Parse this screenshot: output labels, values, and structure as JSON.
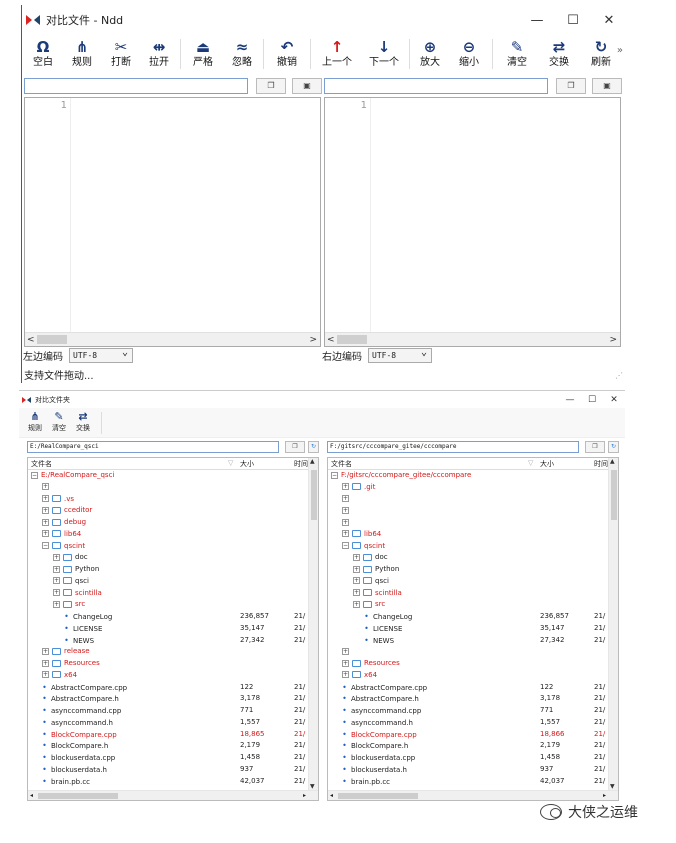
{
  "main": {
    "title": "对比文件 - Ndd",
    "controls": {
      "minimize": "—",
      "maximize": "☐",
      "close": "✕"
    },
    "toolbar": [
      {
        "icon": "Ω",
        "label": "空白",
        "name": "whitespace-button",
        "icon_name": "omega-icon"
      },
      {
        "icon": "⋔",
        "label": "规则",
        "name": "rules-button",
        "icon_name": "rules-icon"
      },
      {
        "icon": "✂",
        "label": "打断",
        "name": "break-button",
        "icon_name": "scissors-icon"
      },
      {
        "icon": "⇹",
        "label": "拉开",
        "name": "separate-button",
        "icon_name": "stretch-icon"
      },
      {
        "icon": "⏏",
        "label": "严格",
        "name": "strict-button",
        "icon_name": "strict-icon"
      },
      {
        "icon": "≈",
        "label": "忽略",
        "name": "ignore-button",
        "icon_name": "approx-icon"
      },
      {
        "icon": "↶",
        "label": "撤销",
        "name": "undo-button",
        "icon_name": "undo-icon"
      },
      {
        "icon": "↑",
        "label": "上一个",
        "name": "prev-diff-button",
        "icon_name": "arrow-up-icon"
      },
      {
        "icon": "↓",
        "label": "下一个",
        "name": "next-diff-button",
        "icon_name": "arrow-down-icon"
      },
      {
        "icon": "⊕",
        "label": "放大",
        "name": "zoom-in-button",
        "icon_name": "zoom-in-icon"
      },
      {
        "icon": "⊖",
        "label": "缩小",
        "name": "zoom-out-button",
        "icon_name": "zoom-out-icon"
      },
      {
        "icon": "✎",
        "label": "清空",
        "name": "clear-button",
        "icon_name": "eraser-icon"
      },
      {
        "icon": "⇄",
        "label": "交换",
        "name": "swap-button",
        "icon_name": "swap-icon"
      },
      {
        "icon": "↻",
        "label": "刷新",
        "name": "refresh-button",
        "icon_name": "refresh-icon"
      }
    ],
    "more": "»",
    "left_path": "",
    "right_path": "",
    "line_number": "1",
    "left_encoding_label": "左边编码",
    "right_encoding_label": "右边编码",
    "encoding_value": "UTF-8",
    "status": "支持文件拖动..."
  },
  "dir": {
    "title": "对比文件夹",
    "controls": {
      "minimize": "—",
      "maximize": "☐",
      "close": "✕"
    },
    "toolbar": [
      {
        "icon": "⋔",
        "label": "规则",
        "name": "dir-rules-button",
        "icon_name": "rules-icon"
      },
      {
        "icon": "✎",
        "label": "清空",
        "name": "dir-clear-button",
        "icon_name": "eraser-icon"
      },
      {
        "icon": "⇄",
        "label": "交换",
        "name": "dir-swap-button",
        "icon_name": "swap-icon"
      }
    ],
    "left_path": "E:/RealCompare_qsci",
    "right_path": "F:/gitsrc/cccompare_gitee/cccompare",
    "col_name": "文件名",
    "col_size": "大小",
    "col_time": "时间",
    "colors": {
      "diff": "#d31919",
      "normal": "#222222"
    },
    "left_rows": [
      {
        "n": "E:/RealCompare_qsci",
        "lv": 0,
        "t": "ex",
        "c": "red",
        "s": "",
        "tm": ""
      },
      {
        "n": "",
        "lv": 1,
        "t": "ex",
        "c": "",
        "s": "",
        "tm": ""
      },
      {
        "n": ".vs",
        "lv": 1,
        "t": "folder",
        "c": "red",
        "s": "",
        "tm": ""
      },
      {
        "n": "cceditor",
        "lv": 1,
        "t": "folder",
        "c": "red",
        "s": "",
        "tm": ""
      },
      {
        "n": "debug",
        "lv": 1,
        "t": "folder",
        "c": "red",
        "s": "",
        "tm": ""
      },
      {
        "n": "lib64",
        "lv": 1,
        "t": "folder",
        "c": "red",
        "s": "",
        "tm": ""
      },
      {
        "n": "qscint",
        "lv": 1,
        "t": "folder",
        "c": "red",
        "s": "",
        "tm": ""
      },
      {
        "n": "doc",
        "lv": 2,
        "t": "folder",
        "c": "",
        "s": "",
        "tm": ""
      },
      {
        "n": "Python",
        "lv": 2,
        "t": "folder",
        "c": "",
        "s": "",
        "tm": ""
      },
      {
        "n": "qsci",
        "lv": 2,
        "t": "folder",
        "c": "",
        "s": "",
        "tm": ""
      },
      {
        "n": "scintilla",
        "lv": 2,
        "t": "folder",
        "c": "red",
        "s": "",
        "tm": ""
      },
      {
        "n": "src",
        "lv": 2,
        "t": "folder",
        "c": "red",
        "s": "",
        "tm": ""
      },
      {
        "n": "ChangeLog",
        "lv": 3,
        "t": "file",
        "c": "",
        "s": "236,857",
        "tm": "21/"
      },
      {
        "n": "LICENSE",
        "lv": 3,
        "t": "file",
        "c": "",
        "s": "35,147",
        "tm": "21/"
      },
      {
        "n": "NEWS",
        "lv": 3,
        "t": "file",
        "c": "",
        "s": "27,342",
        "tm": "21/"
      },
      {
        "n": "release",
        "lv": 1,
        "t": "folder",
        "c": "red",
        "s": "",
        "tm": ""
      },
      {
        "n": "Resources",
        "lv": 1,
        "t": "folder",
        "c": "red",
        "s": "",
        "tm": ""
      },
      {
        "n": "x64",
        "lv": 1,
        "t": "folder",
        "c": "red",
        "s": "",
        "tm": ""
      },
      {
        "n": "AbstractCompare.cpp",
        "lv": 1,
        "t": "file",
        "c": "",
        "s": "122",
        "tm": "21/"
      },
      {
        "n": "AbstractCompare.h",
        "lv": 1,
        "t": "file",
        "c": "",
        "s": "3,178",
        "tm": "21/"
      },
      {
        "n": "asynccommand.cpp",
        "lv": 1,
        "t": "file",
        "c": "",
        "s": "771",
        "tm": "21/"
      },
      {
        "n": "asynccommand.h",
        "lv": 1,
        "t": "file",
        "c": "",
        "s": "1,557",
        "tm": "21/"
      },
      {
        "n": "BlockCompare.cpp",
        "lv": 1,
        "t": "file",
        "c": "red",
        "s": "18,865",
        "tm": "21/"
      },
      {
        "n": "BlockCompare.h",
        "lv": 1,
        "t": "file",
        "c": "",
        "s": "2,179",
        "tm": "21/"
      },
      {
        "n": "blockuserdata.cpp",
        "lv": 1,
        "t": "file",
        "c": "",
        "s": "1,458",
        "tm": "21/"
      },
      {
        "n": "blockuserdata.h",
        "lv": 1,
        "t": "file",
        "c": "",
        "s": "937",
        "tm": "21/"
      },
      {
        "n": "brain.pb.cc",
        "lv": 1,
        "t": "file",
        "c": "",
        "s": "42,037",
        "tm": "21/"
      }
    ],
    "right_rows": [
      {
        "n": "F:/gitsrc/cccompare_gitee/cccompare",
        "lv": 0,
        "t": "ex",
        "c": "red",
        "s": "",
        "tm": ""
      },
      {
        "n": ".git",
        "lv": 1,
        "t": "folder",
        "c": "red",
        "s": "",
        "tm": ""
      },
      {
        "n": "",
        "lv": 1,
        "t": "ex",
        "c": "",
        "s": "",
        "tm": ""
      },
      {
        "n": "",
        "lv": 1,
        "t": "ex",
        "c": "",
        "s": "",
        "tm": ""
      },
      {
        "n": "",
        "lv": 1,
        "t": "ex",
        "c": "",
        "s": "",
        "tm": ""
      },
      {
        "n": "lib64",
        "lv": 1,
        "t": "folder",
        "c": "red",
        "s": "",
        "tm": ""
      },
      {
        "n": "qscint",
        "lv": 1,
        "t": "folder",
        "c": "red",
        "s": "",
        "tm": ""
      },
      {
        "n": "doc",
        "lv": 2,
        "t": "folder",
        "c": "",
        "s": "",
        "tm": ""
      },
      {
        "n": "Python",
        "lv": 2,
        "t": "folder",
        "c": "",
        "s": "",
        "tm": ""
      },
      {
        "n": "qsci",
        "lv": 2,
        "t": "folder",
        "c": "",
        "s": "",
        "tm": ""
      },
      {
        "n": "scintilla",
        "lv": 2,
        "t": "folder",
        "c": "red",
        "s": "",
        "tm": ""
      },
      {
        "n": "src",
        "lv": 2,
        "t": "folder",
        "c": "red",
        "s": "",
        "tm": ""
      },
      {
        "n": "ChangeLog",
        "lv": 3,
        "t": "file",
        "c": "",
        "s": "236,857",
        "tm": "21/"
      },
      {
        "n": "LICENSE",
        "lv": 3,
        "t": "file",
        "c": "",
        "s": "35,147",
        "tm": "21/"
      },
      {
        "n": "NEWS",
        "lv": 3,
        "t": "file",
        "c": "",
        "s": "27,342",
        "tm": "21/"
      },
      {
        "n": "",
        "lv": 1,
        "t": "ex",
        "c": "",
        "s": "",
        "tm": ""
      },
      {
        "n": "Resources",
        "lv": 1,
        "t": "folder",
        "c": "red",
        "s": "",
        "tm": ""
      },
      {
        "n": "x64",
        "lv": 1,
        "t": "folder",
        "c": "red",
        "s": "",
        "tm": ""
      },
      {
        "n": "AbstractCompare.cpp",
        "lv": 1,
        "t": "file",
        "c": "",
        "s": "122",
        "tm": "21/"
      },
      {
        "n": "AbstractCompare.h",
        "lv": 1,
        "t": "file",
        "c": "",
        "s": "3,178",
        "tm": "21/"
      },
      {
        "n": "asynccommand.cpp",
        "lv": 1,
        "t": "file",
        "c": "",
        "s": "771",
        "tm": "21/"
      },
      {
        "n": "asynccommand.h",
        "lv": 1,
        "t": "file",
        "c": "",
        "s": "1,557",
        "tm": "21/"
      },
      {
        "n": "BlockCompare.cpp",
        "lv": 1,
        "t": "file",
        "c": "red",
        "s": "18,866",
        "tm": "21/"
      },
      {
        "n": "BlockCompare.h",
        "lv": 1,
        "t": "file",
        "c": "",
        "s": "2,179",
        "tm": "21/"
      },
      {
        "n": "blockuserdata.cpp",
        "lv": 1,
        "t": "file",
        "c": "",
        "s": "1,458",
        "tm": "21/"
      },
      {
        "n": "blockuserdata.h",
        "lv": 1,
        "t": "file",
        "c": "",
        "s": "937",
        "tm": "21/"
      },
      {
        "n": "brain.pb.cc",
        "lv": 1,
        "t": "file",
        "c": "",
        "s": "42,037",
        "tm": "21/"
      }
    ]
  },
  "watermark": "大侠之运维"
}
